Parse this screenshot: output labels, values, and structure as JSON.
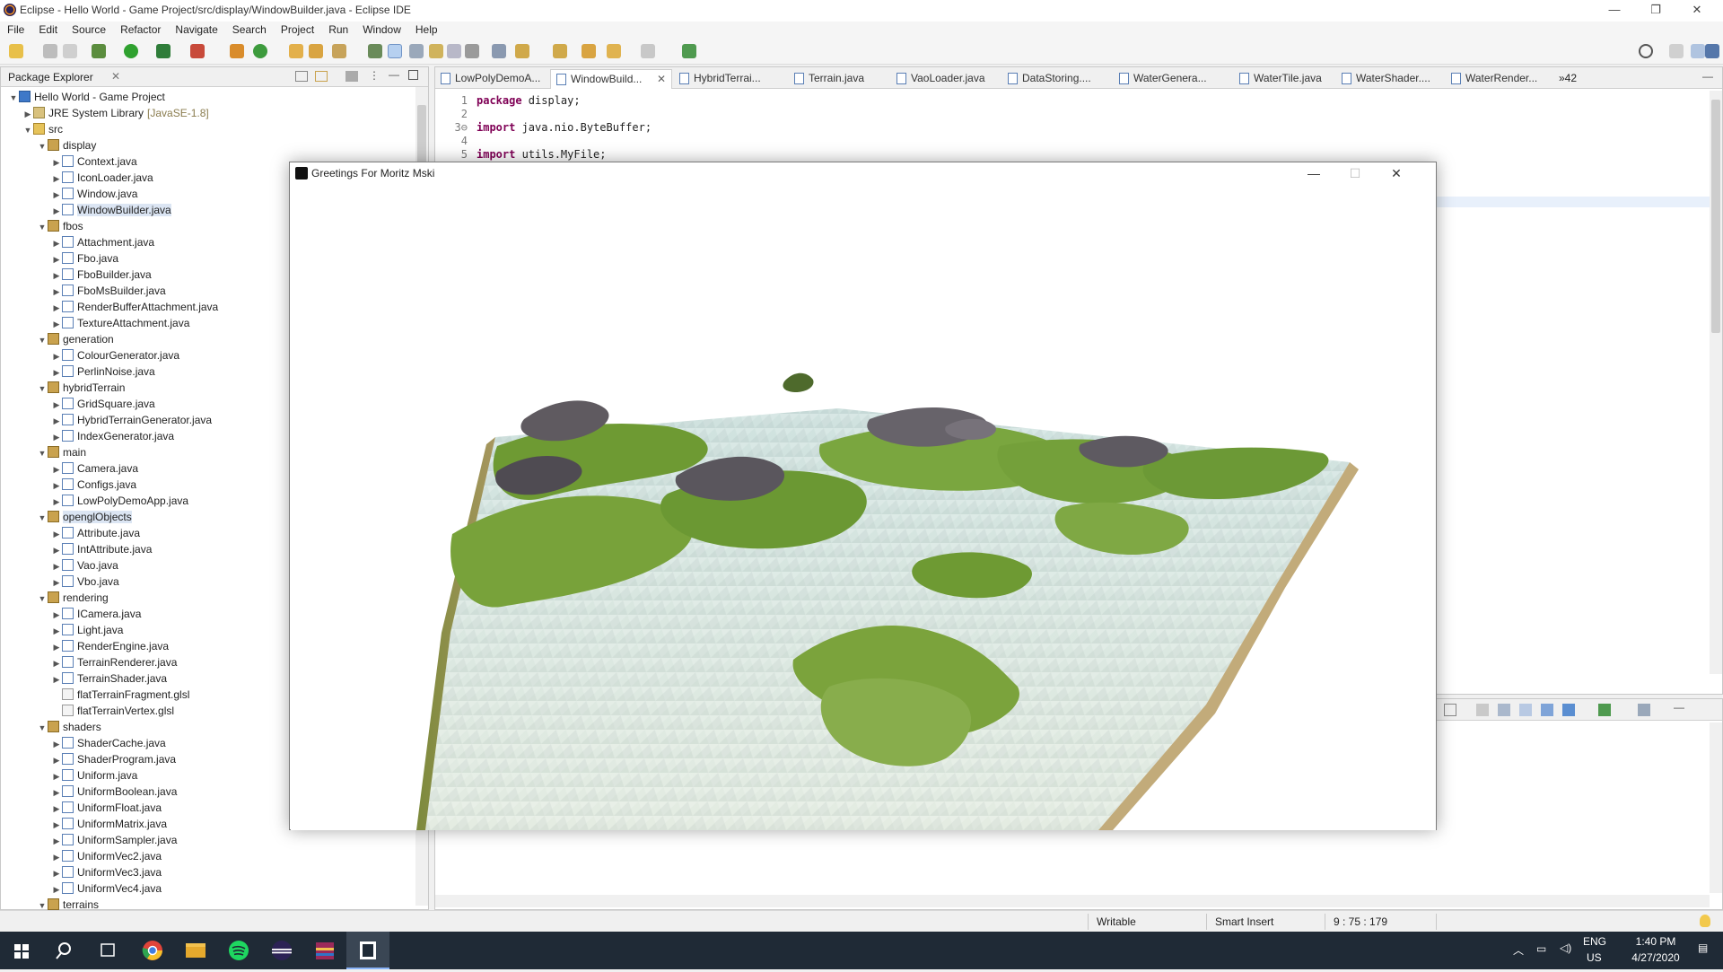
{
  "window": {
    "title": "Eclipse - Hello World - Game Project/src/display/WindowBuilder.java - Eclipse IDE",
    "minimize": "—",
    "maximize": "❐",
    "close": "✕"
  },
  "menu": [
    "File",
    "Edit",
    "Source",
    "Refactor",
    "Navigate",
    "Search",
    "Project",
    "Run",
    "Window",
    "Help"
  ],
  "package_explorer": {
    "title": "Package Explorer",
    "tree": [
      {
        "label": "Hello World - Game Project",
        "level": 0,
        "icon": "project-icon",
        "expanded": true
      },
      {
        "label": "JRE System Library",
        "suffix": "[JavaSE-1.8]",
        "level": 1,
        "icon": "library-icon",
        "expanded": false
      },
      {
        "label": "src",
        "level": 1,
        "icon": "source-folder-icon",
        "expanded": true
      },
      {
        "label": "display",
        "level": 2,
        "icon": "package-icon",
        "expanded": true
      },
      {
        "label": "Context.java",
        "level": 3,
        "icon": "java-file-icon"
      },
      {
        "label": "IconLoader.java",
        "level": 3,
        "icon": "java-file-icon"
      },
      {
        "label": "Window.java",
        "level": 3,
        "icon": "java-file-icon"
      },
      {
        "label": "WindowBuilder.java",
        "level": 3,
        "icon": "java-file-icon",
        "selected": true
      },
      {
        "label": "fbos",
        "level": 2,
        "icon": "package-icon",
        "expanded": true
      },
      {
        "label": "Attachment.java",
        "level": 3,
        "icon": "java-file-icon"
      },
      {
        "label": "Fbo.java",
        "level": 3,
        "icon": "java-file-icon"
      },
      {
        "label": "FboBuilder.java",
        "level": 3,
        "icon": "java-file-icon"
      },
      {
        "label": "FboMsBuilder.java",
        "level": 3,
        "icon": "java-file-icon"
      },
      {
        "label": "RenderBufferAttachment.java",
        "level": 3,
        "icon": "java-file-icon"
      },
      {
        "label": "TextureAttachment.java",
        "level": 3,
        "icon": "java-file-icon"
      },
      {
        "label": "generation",
        "level": 2,
        "icon": "package-icon",
        "expanded": true
      },
      {
        "label": "ColourGenerator.java",
        "level": 3,
        "icon": "java-file-icon"
      },
      {
        "label": "PerlinNoise.java",
        "level": 3,
        "icon": "java-file-icon"
      },
      {
        "label": "hybridTerrain",
        "level": 2,
        "icon": "package-icon",
        "expanded": true
      },
      {
        "label": "GridSquare.java",
        "level": 3,
        "icon": "java-file-icon"
      },
      {
        "label": "HybridTerrainGenerator.java",
        "level": 3,
        "icon": "java-file-icon"
      },
      {
        "label": "IndexGenerator.java",
        "level": 3,
        "icon": "java-file-icon"
      },
      {
        "label": "main",
        "level": 2,
        "icon": "package-icon",
        "expanded": true
      },
      {
        "label": "Camera.java",
        "level": 3,
        "icon": "java-file-icon"
      },
      {
        "label": "Configs.java",
        "level": 3,
        "icon": "java-file-icon"
      },
      {
        "label": "LowPolyDemoApp.java",
        "level": 3,
        "icon": "java-file-icon"
      },
      {
        "label": "openglObjects",
        "level": 2,
        "icon": "package-icon",
        "expanded": true,
        "selected": true
      },
      {
        "label": "Attribute.java",
        "level": 3,
        "icon": "java-file-icon"
      },
      {
        "label": "IntAttribute.java",
        "level": 3,
        "icon": "java-file-icon"
      },
      {
        "label": "Vao.java",
        "level": 3,
        "icon": "java-file-icon"
      },
      {
        "label": "Vbo.java",
        "level": 3,
        "icon": "java-file-icon"
      },
      {
        "label": "rendering",
        "level": 2,
        "icon": "package-icon",
        "expanded": true
      },
      {
        "label": "ICamera.java",
        "level": 3,
        "icon": "java-file-icon"
      },
      {
        "label": "Light.java",
        "level": 3,
        "icon": "java-file-icon"
      },
      {
        "label": "RenderEngine.java",
        "level": 3,
        "icon": "java-file-icon"
      },
      {
        "label": "TerrainRenderer.java",
        "level": 3,
        "icon": "java-file-icon"
      },
      {
        "label": "TerrainShader.java",
        "level": 3,
        "icon": "java-file-icon"
      },
      {
        "label": "flatTerrainFragment.glsl",
        "level": 3,
        "icon": "glsl-file-icon",
        "leaf": true
      },
      {
        "label": "flatTerrainVertex.glsl",
        "level": 3,
        "icon": "glsl-file-icon",
        "leaf": true
      },
      {
        "label": "shaders",
        "level": 2,
        "icon": "package-icon",
        "expanded": true
      },
      {
        "label": "ShaderCache.java",
        "level": 3,
        "icon": "java-file-icon"
      },
      {
        "label": "ShaderProgram.java",
        "level": 3,
        "icon": "java-file-icon"
      },
      {
        "label": "Uniform.java",
        "level": 3,
        "icon": "java-file-icon"
      },
      {
        "label": "UniformBoolean.java",
        "level": 3,
        "icon": "java-file-icon"
      },
      {
        "label": "UniformFloat.java",
        "level": 3,
        "icon": "java-file-icon"
      },
      {
        "label": "UniformMatrix.java",
        "level": 3,
        "icon": "java-file-icon"
      },
      {
        "label": "UniformSampler.java",
        "level": 3,
        "icon": "java-file-icon"
      },
      {
        "label": "UniformVec2.java",
        "level": 3,
        "icon": "java-file-icon"
      },
      {
        "label": "UniformVec3.java",
        "level": 3,
        "icon": "java-file-icon"
      },
      {
        "label": "UniformVec4.java",
        "level": 3,
        "icon": "java-file-icon"
      },
      {
        "label": "terrains",
        "level": 2,
        "icon": "package-icon",
        "expanded": true
      }
    ]
  },
  "editor": {
    "tabs": [
      {
        "label": "LowPolyDemoA..."
      },
      {
        "label": "WindowBuild...",
        "active": true
      },
      {
        "label": "HybridTerrai..."
      },
      {
        "label": "Terrain.java"
      },
      {
        "label": "VaoLoader.java"
      },
      {
        "label": "DataStoring...."
      },
      {
        "label": "WaterGenera..."
      },
      {
        "label": "WaterTile.java"
      },
      {
        "label": "WaterShader...."
      },
      {
        "label": "WaterRender..."
      }
    ],
    "overflow": "»42",
    "lines": [
      {
        "num": "1",
        "kw": "package",
        "rest": " display;"
      },
      {
        "num": "2",
        "kw": "",
        "rest": ""
      },
      {
        "num": "3⊖",
        "kw": "import",
        "rest": " java.nio.ByteBuffer;"
      },
      {
        "num": "4",
        "kw": "",
        "rest": ""
      },
      {
        "num": "5",
        "kw": "import",
        "rest": " utils.MyFile;"
      }
    ]
  },
  "game_window": {
    "title": "Greetings For Moritz Mski",
    "minimize": "—",
    "maximize": "☐",
    "close": "✕"
  },
  "status": {
    "writable": "Writable",
    "insert_mode": "Smart Insert",
    "position": "9 : 75 : 179"
  },
  "taskbar": {
    "lang": "ENG",
    "region": "US",
    "time": "1:40 PM",
    "date": "4/27/2020"
  },
  "colors": {
    "water": "#c7dcd8",
    "grass": "#6e9a33",
    "rock": "#5f5a60",
    "sand": "#c2ab7a",
    "taskbar": "#1f2a36"
  }
}
